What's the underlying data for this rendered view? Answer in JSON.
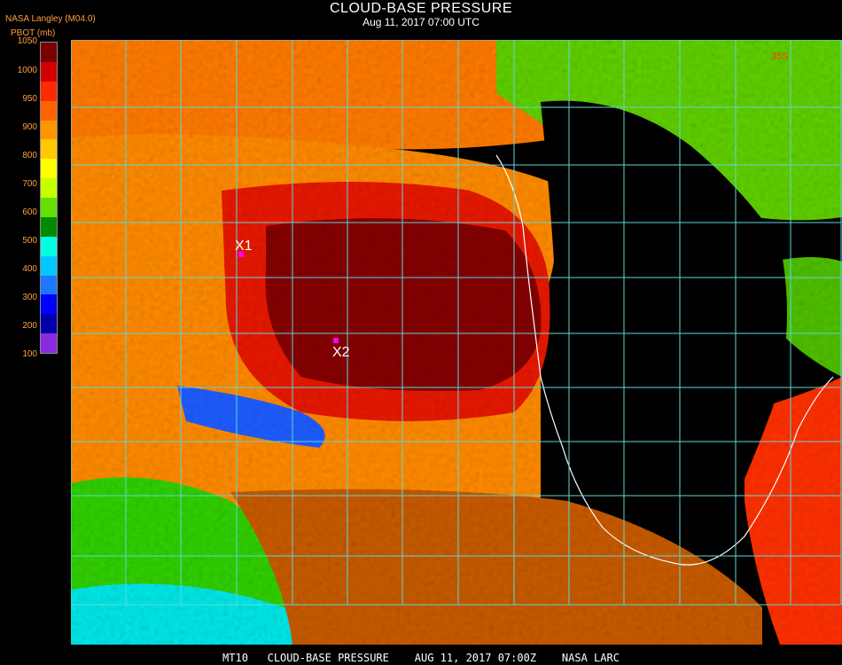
{
  "header": {
    "title": "CLOUD-BASE PRESSURE",
    "subtitle": "Aug 11, 2017 07:00 UTC",
    "agency": "NASA Langley (M04.0)",
    "units": "PBOT (mb)"
  },
  "legend": {
    "ticks": [
      "1050",
      "1000",
      "950",
      "900",
      "850",
      "800",
      "750",
      "700",
      "650",
      "600",
      "550",
      "500",
      "450",
      "400",
      "350",
      "300",
      "250",
      "200",
      "150",
      "100"
    ],
    "colors": [
      "#7a0000",
      "#d40000",
      "#ff2a00",
      "#ff6400",
      "#ff9600",
      "#ffc800",
      "#ffff00",
      "#c8ff00",
      "#64e000",
      "#008c00",
      "#00ffe0",
      "#00c8ff",
      "#1e78ff",
      "#0000ff",
      "#0000aa",
      "#8a2be2"
    ],
    "scale_labels": [
      "1050",
      "1000",
      "950",
      "900",
      "800",
      "700",
      "600",
      "500",
      "400",
      "300",
      "200",
      "100"
    ]
  },
  "markers": [
    {
      "label": "X1"
    },
    {
      "label": "X2"
    }
  ],
  "grid_labels": [
    {
      "text": "35S"
    },
    {
      "text": "35S"
    }
  ],
  "footer": {
    "text": "MT10   CLOUD-BASE PRESSURE    AUG 11, 2017 07:00Z    NASA LARC"
  },
  "palette": {
    "grid": "#5fd7d7",
    "coast": "#ffffff",
    "marker": "#ff00ff",
    "ocean_clear": "#000000"
  }
}
